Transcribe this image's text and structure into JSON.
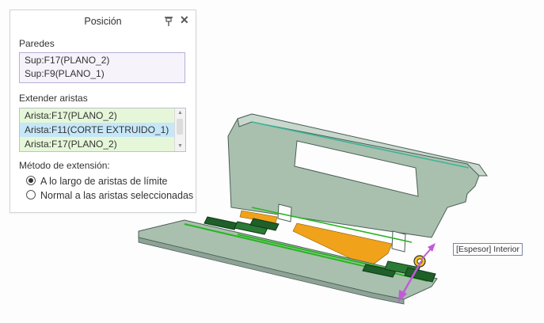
{
  "panel": {
    "title": "Posición",
    "walls_label": "Paredes",
    "walls": [
      "Sup:F17(PLANO_2)",
      "Sup:F9(PLANO_1)"
    ],
    "extend_label": "Extender aristas",
    "edges": [
      {
        "label": "Arista:F17(PLANO_2)",
        "selected": false
      },
      {
        "label": "Arista:F11(CORTE EXTRUIDO_1)",
        "selected": true
      },
      {
        "label": "Arista:F17(PLANO_2)",
        "selected": false
      }
    ],
    "method_label": "Método de extensión:",
    "options": [
      {
        "label": "A lo largo de aristas de límite",
        "checked": true
      },
      {
        "label": "Normal a las aristas seleccionadas",
        "checked": false
      }
    ]
  },
  "viewport": {
    "thickness_tag": "[Espesor] Interior"
  },
  "colors": {
    "part_fill": "#a9c0ae",
    "part_edge": "#4a5f58",
    "selection_green": "#26b51f",
    "orange_flange": "#f0a21a",
    "arrow_magenta": "#c25ad8"
  }
}
